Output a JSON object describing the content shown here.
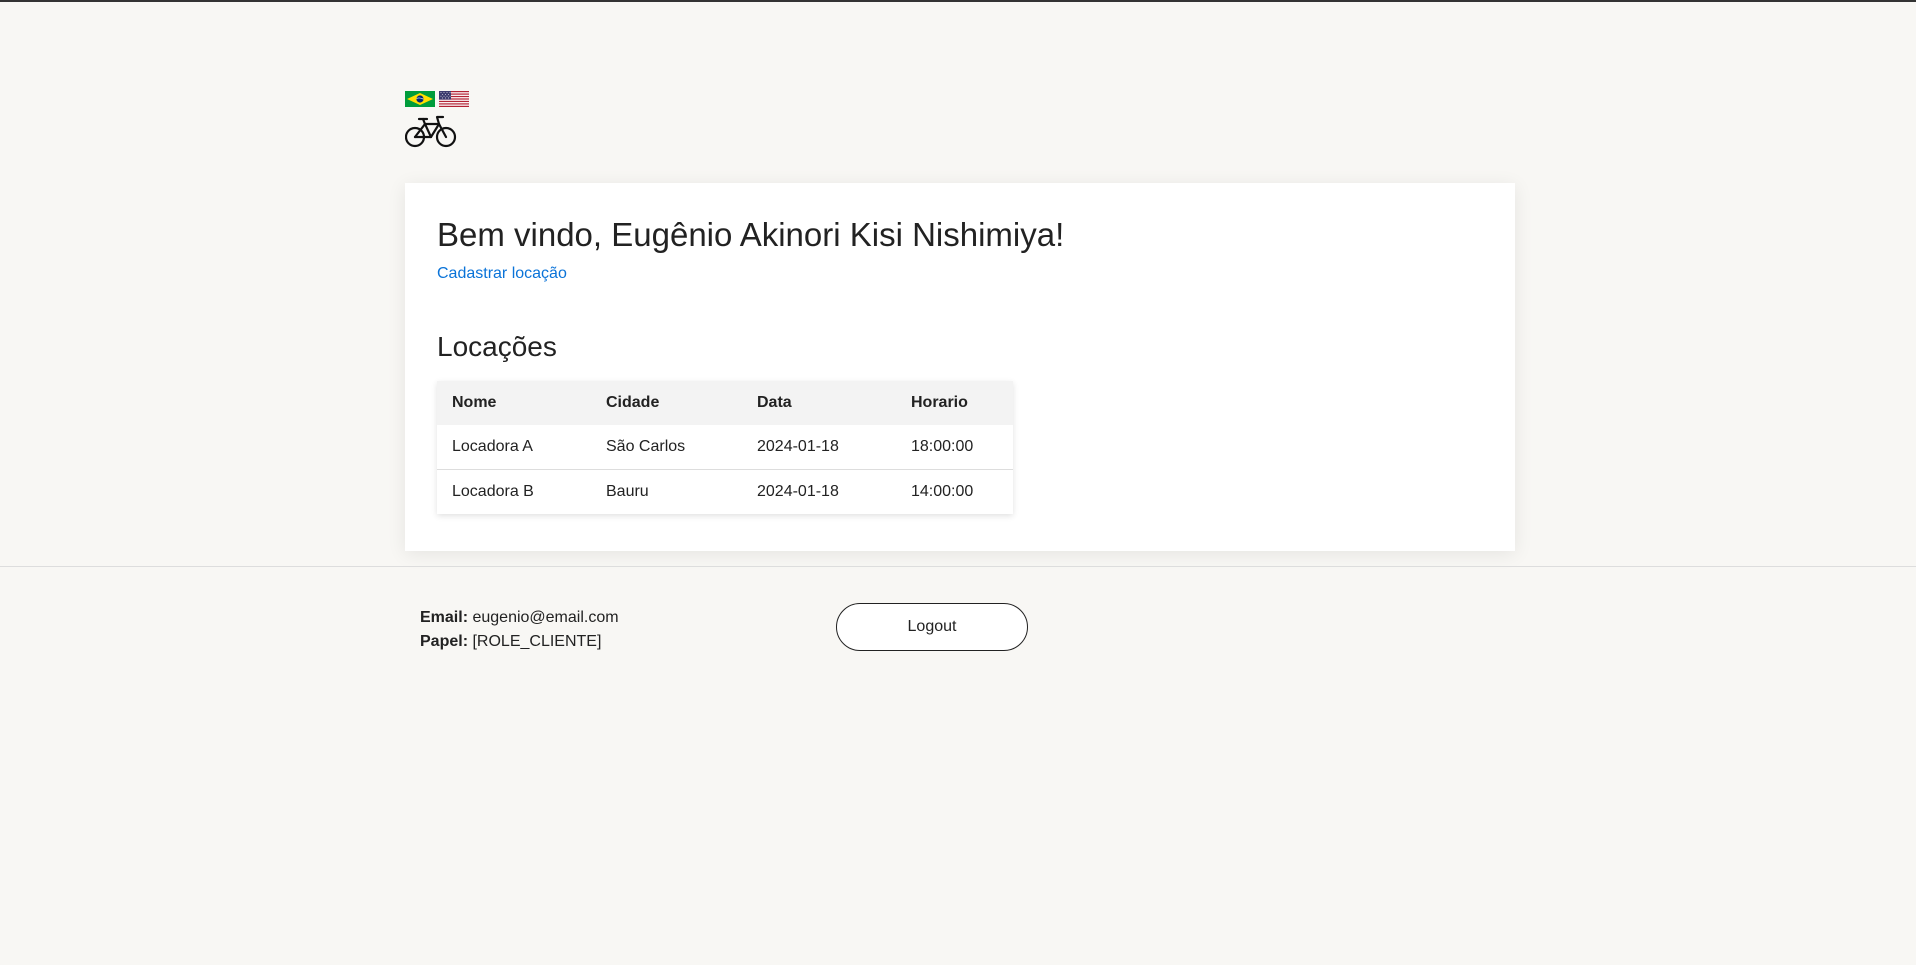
{
  "header": {
    "flags": [
      {
        "name": "brazil-flag-icon",
        "colors": [
          "#009c3b",
          "#ffdf00",
          "#002776"
        ]
      },
      {
        "name": "usa-flag-icon",
        "colors": [
          "#b22234",
          "#ffffff",
          "#3c3b6e"
        ]
      }
    ],
    "logo_icon": "bicycle-icon"
  },
  "main": {
    "welcome": "Bem vindo, Eugênio Akinori Kisi Nishimiya!",
    "register_link": "Cadastrar locação",
    "section_title": "Locações",
    "table": {
      "columns": [
        "Nome",
        "Cidade",
        "Data",
        "Horario"
      ],
      "rows": [
        [
          "Locadora A",
          "São Carlos",
          "2024-01-18",
          "18:00:00"
        ],
        [
          "Locadora B",
          "Bauru",
          "2024-01-18",
          "14:00:00"
        ]
      ]
    }
  },
  "footer": {
    "email_label": "Email:",
    "email": "eugenio@email.com",
    "role_label": "Papel:",
    "role": "[ROLE_CLIENTE]",
    "logout_label": "Logout"
  },
  "colors": {
    "background": "#f8f7f4",
    "link": "#0a73d8",
    "card": "#ffffff"
  }
}
